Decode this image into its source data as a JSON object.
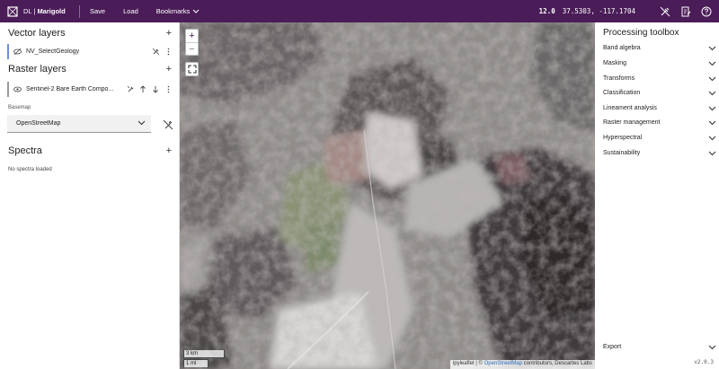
{
  "topbar": {
    "brand_prefix": "DL",
    "brand_sep": " | ",
    "brand_name": "Marigold",
    "menu": [
      "Save",
      "Load",
      "Bookmarks"
    ],
    "zoom": "12.0",
    "coords": "37.5303, -117.1704",
    "icons": [
      "draw-off-icon",
      "document-edit-icon",
      "help-icon"
    ]
  },
  "left": {
    "vector_title": "Vector layers",
    "vector_layers": [
      {
        "label": "NV_SelectGeology"
      }
    ],
    "raster_title": "Raster layers",
    "raster_layers": [
      {
        "label": "Sentinel-2 Bare Earth Compo..."
      }
    ],
    "basemap_label": "Basemap",
    "basemap_value": "OpenStreetMap",
    "spectra_title": "Spectra",
    "spectra_empty": "No spectra loaded",
    "add_symbol": "+"
  },
  "map": {
    "zoom_in": "+",
    "zoom_out": "−",
    "scale_km": "3 km",
    "scale_mi": "1 mi",
    "attr_ipy": "ipyleaflet | © ",
    "attr_osm": "OpenStreetMap",
    "attr_rest": " contributors, Descartes Labs"
  },
  "right": {
    "title": "Processing toolbox",
    "items": [
      "Band algebra",
      "Masking",
      "Transforms",
      "Classification",
      "Lineament analysis",
      "Raster management",
      "Hyperspectral",
      "Sustainability"
    ],
    "export": "Export",
    "version": "v2.0.3"
  },
  "colors": {
    "topbar": "#4b1d58",
    "vector_accent": "#6f8fd6",
    "raster_accent": "#999999"
  }
}
